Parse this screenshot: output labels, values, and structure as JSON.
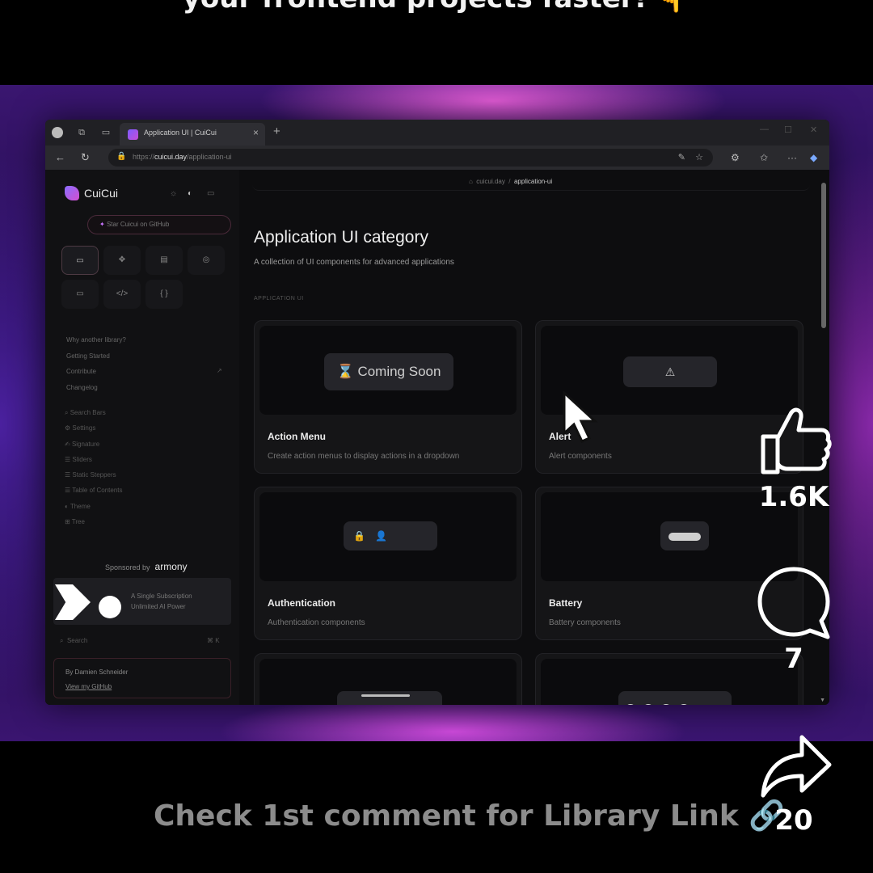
{
  "video": {
    "top_caption": "your frontend projects faster! 👇",
    "bottom_caption": "Check 1st comment for Library Link 🔗"
  },
  "actions": {
    "like_count": "1.6K",
    "comment_count": "7",
    "share_count": "20"
  },
  "browser": {
    "tab_title": "Application UI | CuiCui",
    "url_scheme": "https://",
    "url_host": "cuicui.day",
    "url_path": "/application-ui"
  },
  "site": {
    "logo": "CuiCui",
    "star_github": "Star Cuicui on GitHub",
    "breadcrumb_root": "cuicui.day",
    "breadcrumb_current": "application-ui",
    "nav_links": [
      "Why another library?",
      "Getting Started",
      "Contribute",
      "Changelog"
    ],
    "component_links": [
      "Search Bars",
      "Settings",
      "Signature",
      "Sliders",
      "Static Steppers",
      "Table of Contents",
      "Theme",
      "Tree"
    ],
    "sponsored_by": "Sponsored by",
    "sponsor_name": "armony",
    "ad_line1": "A Single Subscription",
    "ad_line2": "Unlimited AI Power",
    "search_placeholder": "Search",
    "search_shortcut": "⌘ K",
    "author": "By Damien Schneider",
    "author_link": "View my GitHub"
  },
  "page": {
    "title": "Application UI category",
    "subtitle": "A collection of UI components for advanced applications",
    "section_label": "APPLICATION UI",
    "cards": [
      {
        "title": "Action Menu",
        "desc": "Create action menus to display actions in a dropdown",
        "preview_label": "Coming Soon"
      },
      {
        "title": "Alert",
        "desc": "Alert components"
      },
      {
        "title": "Authentication",
        "desc": "Authentication components"
      },
      {
        "title": "Battery",
        "desc": "Battery components"
      }
    ]
  },
  "icons": {
    "like": "thumbs-up-icon",
    "comment": "comment-bubble-icon",
    "share": "share-arrow-icon",
    "cursor": "mouse-pointer-icon"
  }
}
